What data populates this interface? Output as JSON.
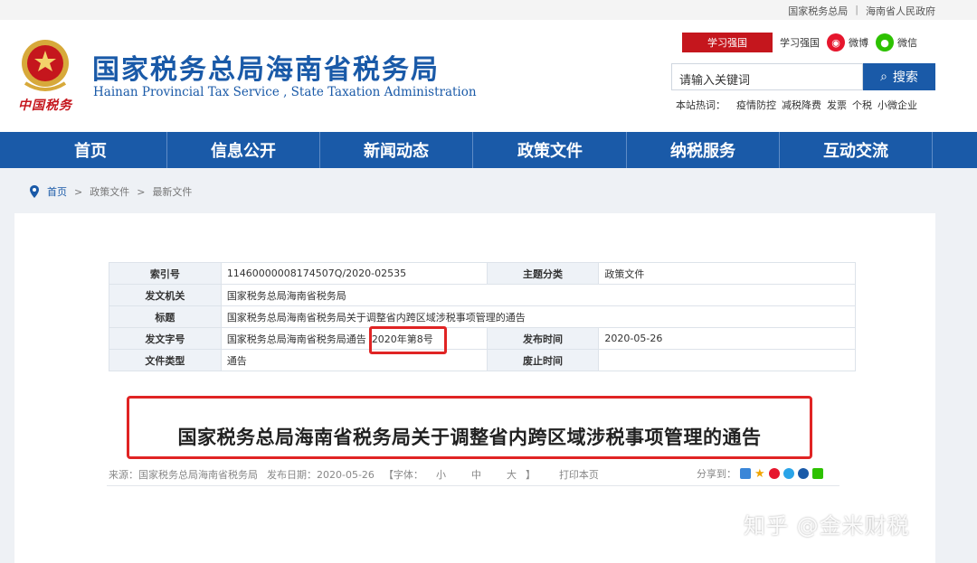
{
  "topbar": {
    "link1": "国家税务总局",
    "sep": "|",
    "link2": "海南省人民政府"
  },
  "header": {
    "title": "国家税务总局海南省税务局",
    "subtitle": "Hainan Provincial Tax Service , State Taxation Administration",
    "emblem_text": "中国税务",
    "xuexi_label": "学习强国",
    "weibo_label": "微博",
    "weixin_label": "微信",
    "search_placeholder": "请输入关键词",
    "search_button": "搜索",
    "hot_label": "本站热词：",
    "hot_words": [
      "疫情防控",
      "减税降费",
      "发票",
      "个税",
      "小微企业"
    ]
  },
  "nav": [
    "首页",
    "信息公开",
    "新闻动态",
    "政策文件",
    "纳税服务",
    "互动交流"
  ],
  "breadcrumb": {
    "home": "首页",
    "level1": "政策文件",
    "level2": "最新文件",
    "sep": ">"
  },
  "meta_table": {
    "index_label": "索引号",
    "index_value": "11460000008174507Q/2020-02535",
    "topic_label": "主题分类",
    "topic_value": "政策文件",
    "issuer_label": "发文机关",
    "issuer_value": "国家税务总局海南省税务局",
    "title_label": "标题",
    "title_value": "国家税务总局海南省税务局关于调整省内跨区域涉税事项管理的通告",
    "docno_label": "发文字号",
    "docno_value": "国家税务总局海南省税务局通告",
    "docno_highlight": "2020年第8号",
    "pubdate_label": "发布时间",
    "pubdate_value": "2020-05-26",
    "type_label": "文件类型",
    "type_value": "通告",
    "abolish_label": "废止时间",
    "abolish_value": ""
  },
  "article": {
    "title": "国家税务总局海南省税务局关于调整省内跨区域涉税事项管理的通告",
    "source": "来源：国家税务总局海南省税务局",
    "date": "发布日期：2020-05-26",
    "font_label": "【字体：",
    "font_small": "小",
    "font_medium": "中",
    "font_large": "大",
    "font_close": "】",
    "print": "打印本页",
    "share": "分享到："
  },
  "watermark": "知乎 @金米财税",
  "colors": {
    "brand_blue": "#1a5aa8",
    "highlight_red": "#e02424"
  }
}
